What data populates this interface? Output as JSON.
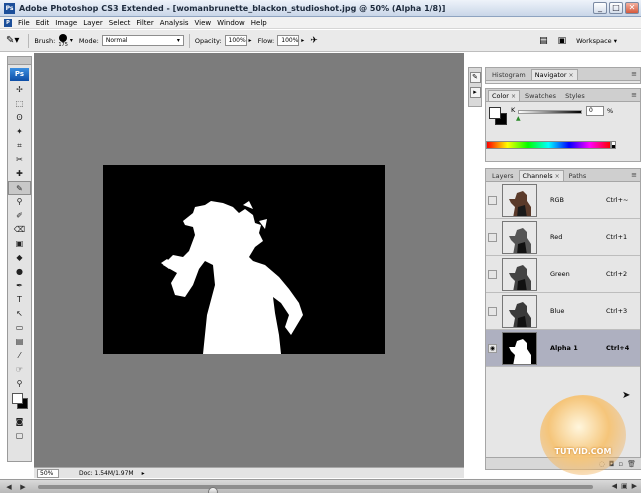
{
  "window": {
    "title": "Adobe Photoshop CS3 Extended - [womanbrunette_blackon_studioshot.jpg @ 50% (Alpha 1/8)]",
    "app_icon": "Ps",
    "minimize": "_",
    "maximize": "□",
    "close": "✕"
  },
  "menu": [
    "File",
    "Edit",
    "Image",
    "Layer",
    "Select",
    "Filter",
    "Analysis",
    "View",
    "Window",
    "Help"
  ],
  "options_bar": {
    "brush_label": "Brush:",
    "brush_size": "175",
    "mode_label": "Mode:",
    "mode_value": "Normal",
    "opacity_label": "Opacity:",
    "opacity_value": "100%",
    "flow_label": "Flow:",
    "flow_value": "100%",
    "workspace_label": "Workspace ▾"
  },
  "toolbox": {
    "logo": "Ps",
    "tools": [
      "▸✢",
      "⬚",
      "ʘ",
      "✦",
      "⌗",
      "✒",
      "✎",
      "⚲",
      "✐",
      "⌫",
      "▣",
      "💧",
      "●",
      "✋",
      "T",
      "↖",
      "▭",
      "☞",
      "🔍"
    ]
  },
  "status": {
    "zoom": "50%",
    "doc": "Doc: 1.54M/1.97M"
  },
  "panels": {
    "top_tabs": [
      {
        "label": "Histogram",
        "active": false
      },
      {
        "label": "Navigator",
        "active": true
      }
    ],
    "color_tabs": [
      {
        "label": "Color",
        "active": true
      },
      {
        "label": "Swatches",
        "active": false
      },
      {
        "label": "Styles",
        "active": false
      }
    ],
    "color": {
      "k_label": "K",
      "k_value": "0",
      "pct": "%"
    },
    "channel_tabs": [
      {
        "label": "Layers",
        "active": false
      },
      {
        "label": "Channels",
        "active": true
      },
      {
        "label": "Paths",
        "active": false
      }
    ],
    "channels": [
      {
        "name": "RGB",
        "shortcut": "Ctrl+~",
        "selected": false
      },
      {
        "name": "Red",
        "shortcut": "Ctrl+1",
        "selected": false
      },
      {
        "name": "Green",
        "shortcut": "Ctrl+2",
        "selected": false
      },
      {
        "name": "Blue",
        "shortcut": "Ctrl+3",
        "selected": false
      },
      {
        "name": "Alpha 1",
        "shortcut": "Ctrl+4",
        "selected": true
      }
    ]
  },
  "watermark": "TUTVID.COM",
  "colors": {
    "workspace_bg": "#7c7c7c",
    "selected_channel": "#aeb0c0"
  }
}
